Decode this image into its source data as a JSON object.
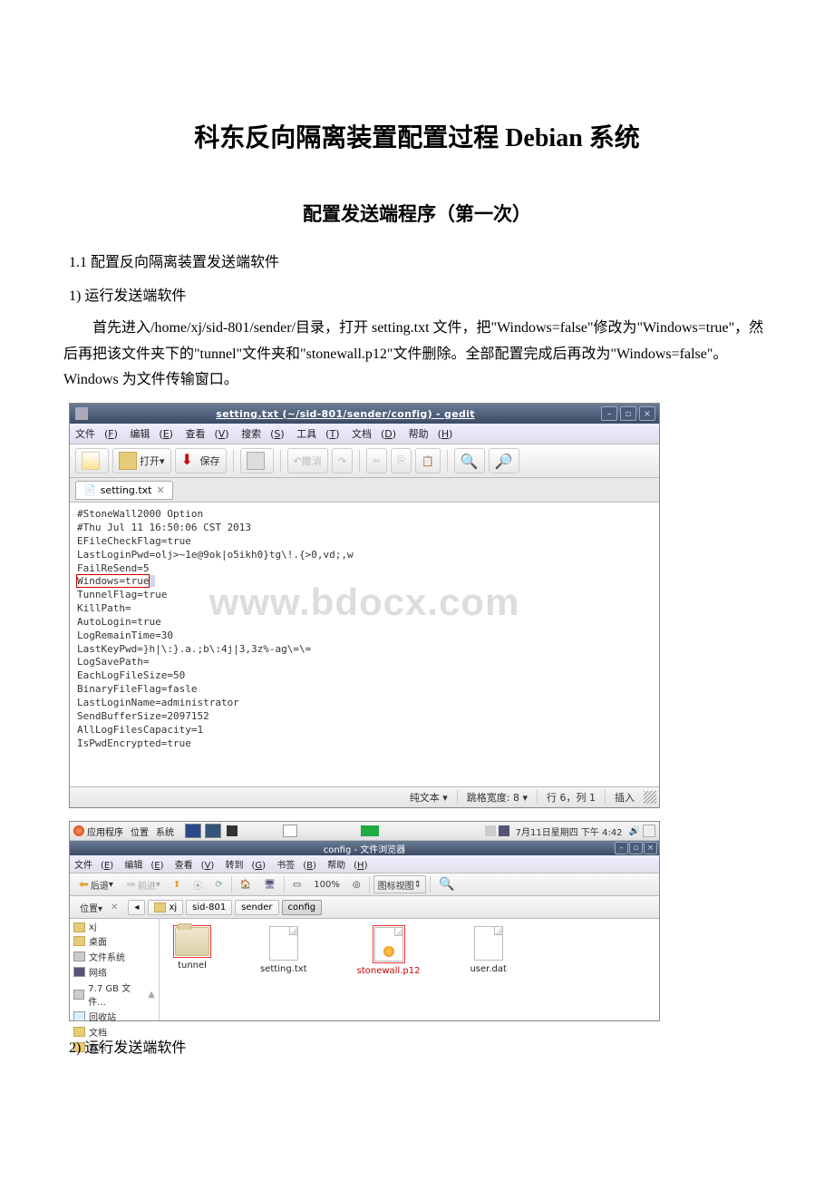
{
  "title": "科东反向隔离装置配置过程 Debian 系统",
  "subtitle": "配置发送端程序（第一次）",
  "sec11": "1.1  配置反向隔离装置发送端软件",
  "step1": "1) 运行发送端软件",
  "para1": "首先进入/home/xj/sid-801/sender/目录，打开 setting.txt 文件，把\"Windows=false\"修改为\"Windows=true\"，然后再把该文件夹下的\"tunnel\"文件夹和\"stonewall.p12\"文件删除。全部配置完成后再改为\"Windows=false\"。Windows 为文件传输窗口。",
  "step2": "2) 运行发送端软件",
  "gedit": {
    "window_title": "setting.txt (~/sid-801/sender/config) - gedit",
    "menu": {
      "file": "文件",
      "edit": "编辑",
      "view": "查看",
      "search": "搜索",
      "tools": "工具",
      "doc": "文档",
      "help": "帮助",
      "file_u": "F",
      "edit_u": "E",
      "view_u": "V",
      "search_u": "S",
      "tools_u": "T",
      "doc_u": "D",
      "help_u": "H"
    },
    "tools": {
      "open": "打开",
      "save": "保存",
      "undo": "撤消"
    },
    "tab": "setting.txt",
    "content": {
      "l1": "#StoneWall2000 Option",
      "l2": "#Thu Jul 11 16:50:06 CST 2013",
      "l3": "EFileCheckFlag=true",
      "l4": "LastLoginPwd=olj>~1e@9ok|o5ikh0}tg\\!.{>0,vd;,w",
      "l5": "FailReSend=5",
      "l6": "Windows=true",
      "l7": "TunnelFlag=true",
      "l8": "KillPath=",
      "l9": "AutoLogin=true",
      "l10": "LogRemainTime=30",
      "l11": "LastKeyPwd=}h|\\:}.a.;b\\:4j|3,3z%-ag\\=\\=",
      "l12": "LogSavePath=",
      "l13": "EachLogFileSize=50",
      "l14": "BinaryFileFlag=fasle",
      "l15": "LastLoginName=administrator",
      "l16": "SendBufferSize=2097152",
      "l17": "AllLogFilesCapacity=1",
      "l18": "IsPwdEncrypted=true"
    },
    "status": {
      "syntax": "纯文本 ▾",
      "tab": "跳格宽度:  8 ▾",
      "pos": "行 6，列 1",
      "ins": "插入"
    },
    "watermark": "www.bdocx.com"
  },
  "panel": {
    "apps": "应用程序",
    "places": "位置",
    "system": "系统",
    "clock": "7月11日星期四 下午 4:42"
  },
  "fm": {
    "title": "config - 文件浏览器",
    "menu": {
      "file": "文件",
      "edit": "编辑",
      "view": "查看",
      "goto": "转到",
      "bookmark": "书签",
      "help": "帮助",
      "file_u": "E",
      "edit_u": "E",
      "view_u": "V",
      "goto_u": "G",
      "bookmark_u": "B",
      "help_u": "H"
    },
    "tools": {
      "back": "后退",
      "fwd": "前进",
      "zoom": "100%",
      "view": "图标视图"
    },
    "loc": "位置▾",
    "crumbs": {
      "c0": "◂",
      "c1": "xj",
      "c2": "sid-801",
      "c3": "sender",
      "c4": "config"
    },
    "sidebar": {
      "s1": "xj",
      "s2": "桌面",
      "s3": "文件系统",
      "s4": "网络",
      "s5": "7.7 GB 文件...",
      "s6": "回收站",
      "s7": "文档",
      "s8": "音乐"
    },
    "files": {
      "f1": "tunnel",
      "f2": "setting.txt",
      "f3": "stonewall.p12",
      "f4": "user.dat"
    }
  }
}
